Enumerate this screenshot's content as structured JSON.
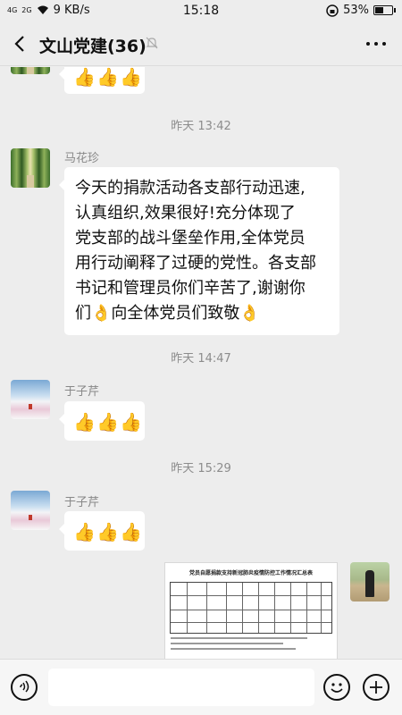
{
  "status_bar": {
    "network": "4G",
    "network2": "2G",
    "speed": "9 KB/s",
    "time": "15:18",
    "battery": "53%",
    "battery_level": 0.53
  },
  "header": {
    "title": "文山党建(36)",
    "back_icon": "chevron-left-icon",
    "mute_icon": "bell-off-icon",
    "more_icon": "more-dots-icon"
  },
  "messages": [
    {
      "type": "emoji",
      "emoji": [
        "👍",
        "👍",
        "👍"
      ]
    },
    {
      "type": "time",
      "text": "昨天 13:42"
    },
    {
      "type": "text",
      "sender": "马花珍",
      "text_lines": [
        "今天的捐款活动各支部行动迅速,",
        "认真组织,效果很好!充分体现了",
        "党支部的战斗堡垒作用,全体党员",
        "用行动阐释了过硬的党性。各支部",
        "书记和管理员你们辛苦了,谢谢你",
        "们👌向全体党员们致敬👌"
      ]
    },
    {
      "type": "time",
      "text": "昨天 14:47"
    },
    {
      "type": "emoji",
      "sender": "于子芹",
      "emoji": [
        "👍",
        "👍",
        "👍"
      ]
    },
    {
      "type": "time",
      "text": "昨天 15:29"
    },
    {
      "type": "emoji",
      "sender": "于子芹",
      "emoji": [
        "👍",
        "👍",
        "👍"
      ]
    },
    {
      "type": "image",
      "direction": "outgoing",
      "doc_title": "党员自愿捐款支持新冠肺炎疫情防控工作情况汇总表"
    }
  ],
  "input_bar": {
    "voice_icon": "voice-icon",
    "input_value": "",
    "emoji_icon": "smiley-icon",
    "plus_icon": "plus-icon"
  },
  "colors": {
    "background": "#ededed",
    "bubble": "#ffffff",
    "timestamp": "#8c8c8c"
  }
}
